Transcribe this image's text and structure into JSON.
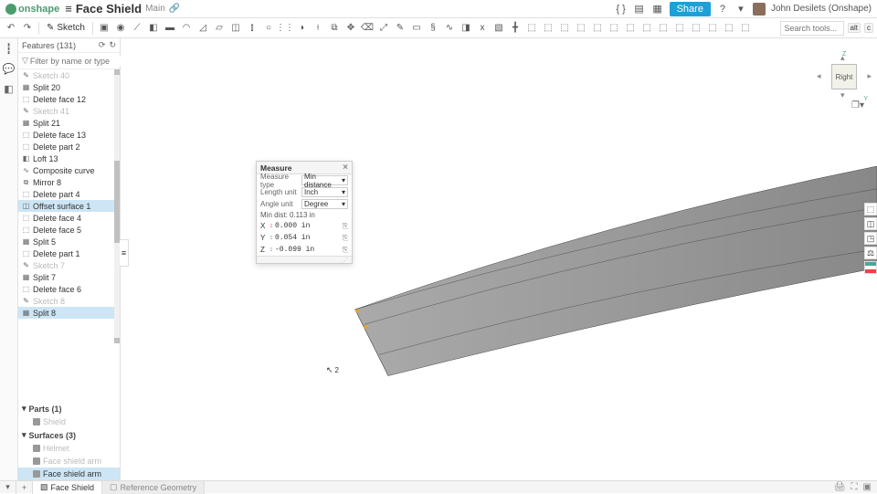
{
  "brand": "onshape",
  "doc": {
    "title": "Face Shield",
    "subtitle": "Main"
  },
  "share_label": "Share",
  "user": "John Desilets (Onshape)",
  "sketch_label": "Sketch",
  "search": {
    "placeholder": "Search tools...",
    "kbd1": "alt",
    "kbd2": "c"
  },
  "features_header": "Features (131)",
  "filter_placeholder": "Filter by name or type",
  "features": [
    {
      "label": "Sketch 40",
      "icon": "✎",
      "suppressed": true
    },
    {
      "label": "Split 20",
      "icon": "▦"
    },
    {
      "label": "Delete face 12",
      "icon": "⬚"
    },
    {
      "label": "Sketch 41",
      "icon": "✎",
      "suppressed": true
    },
    {
      "label": "Split 21",
      "icon": "▦"
    },
    {
      "label": "Delete face 13",
      "icon": "⬚"
    },
    {
      "label": "Delete part 2",
      "icon": "⬚"
    },
    {
      "label": "Loft 13",
      "icon": "◧"
    },
    {
      "label": "Composite curve",
      "icon": "∿"
    },
    {
      "label": "Mirror 8",
      "icon": "⧉"
    },
    {
      "label": "Delete part 4",
      "icon": "⬚"
    },
    {
      "label": "Offset surface 1",
      "icon": "◫",
      "selected": true
    },
    {
      "label": "Delete face 4",
      "icon": "⬚"
    },
    {
      "label": "Delete face 5",
      "icon": "⬚"
    },
    {
      "label": "Split 5",
      "icon": "▦"
    },
    {
      "label": "Delete part 1",
      "icon": "⬚"
    },
    {
      "label": "Sketch 7",
      "icon": "✎",
      "suppressed": true
    },
    {
      "label": "Split 7",
      "icon": "▦"
    },
    {
      "label": "Delete face 6",
      "icon": "⬚"
    },
    {
      "label": "Sketch 8",
      "icon": "✎",
      "suppressed": true
    },
    {
      "label": "Split 8",
      "icon": "▦",
      "selected": true
    }
  ],
  "parts": {
    "header": "Parts (1)",
    "items": [
      {
        "label": "Shield",
        "suppressed": true
      }
    ]
  },
  "surfaces": {
    "header": "Surfaces (3)",
    "items": [
      {
        "label": "Helmet",
        "suppressed": true
      },
      {
        "label": "Face shield arm",
        "suppressed": true
      },
      {
        "label": "Face shield arm",
        "selected": true
      }
    ]
  },
  "measure": {
    "title": "Measure",
    "type_label": "Measure type",
    "type_value": "Min distance",
    "length_label": "Length unit",
    "length_value": "Inch",
    "angle_label": "Angle unit",
    "angle_value": "Degree",
    "mindist": "Min dist: 0.113 in",
    "x": {
      "axis": "X",
      "val": "0.000 in"
    },
    "y": {
      "axis": "Y",
      "val": "0.054 in"
    },
    "z": {
      "axis": "Z",
      "val": "-0.099 in"
    }
  },
  "orient": {
    "face": "Right",
    "z": "Z",
    "y": "Y"
  },
  "cursor_count": "2",
  "tabs": {
    "t1": "Face Shield",
    "t2": "Reference Geometry"
  }
}
